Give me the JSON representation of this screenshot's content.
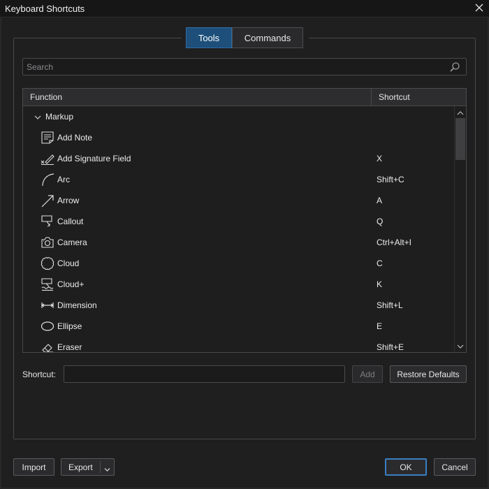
{
  "window": {
    "title": "Keyboard Shortcuts"
  },
  "tabs": [
    {
      "label": "Tools",
      "active": true
    },
    {
      "label": "Commands",
      "active": false
    }
  ],
  "search": {
    "placeholder": "Search",
    "value": ""
  },
  "table": {
    "columns": [
      "Function",
      "Shortcut"
    ],
    "group": {
      "label": "Markup",
      "expanded": true
    },
    "rows": [
      {
        "label": "Add Note",
        "shortcut": "",
        "icon": "note-icon"
      },
      {
        "label": "Add Signature Field",
        "shortcut": "X",
        "icon": "signature-icon"
      },
      {
        "label": "Arc",
        "shortcut": "Shift+C",
        "icon": "arc-icon"
      },
      {
        "label": "Arrow",
        "shortcut": "A",
        "icon": "arrow-icon"
      },
      {
        "label": "Callout",
        "shortcut": "Q",
        "icon": "callout-icon"
      },
      {
        "label": "Camera",
        "shortcut": "Ctrl+Alt+I",
        "icon": "camera-icon"
      },
      {
        "label": "Cloud",
        "shortcut": "C",
        "icon": "cloud-icon"
      },
      {
        "label": "Cloud+",
        "shortcut": "K",
        "icon": "cloud-plus-icon"
      },
      {
        "label": "Dimension",
        "shortcut": "Shift+L",
        "icon": "dimension-icon"
      },
      {
        "label": "Ellipse",
        "shortcut": "E",
        "icon": "ellipse-icon"
      },
      {
        "label": "Eraser",
        "shortcut": "Shift+E",
        "icon": "eraser-icon"
      }
    ]
  },
  "editor": {
    "shortcut_label": "Shortcut:",
    "shortcut_value": "",
    "add_label": "Add",
    "restore_label": "Restore Defaults"
  },
  "footer": {
    "import_label": "Import",
    "export_label": "Export",
    "ok_label": "OK",
    "cancel_label": "Cancel"
  },
  "colors": {
    "accent": "#1d4f7a",
    "background": "#1f1f20",
    "titlebar": "#161617"
  }
}
